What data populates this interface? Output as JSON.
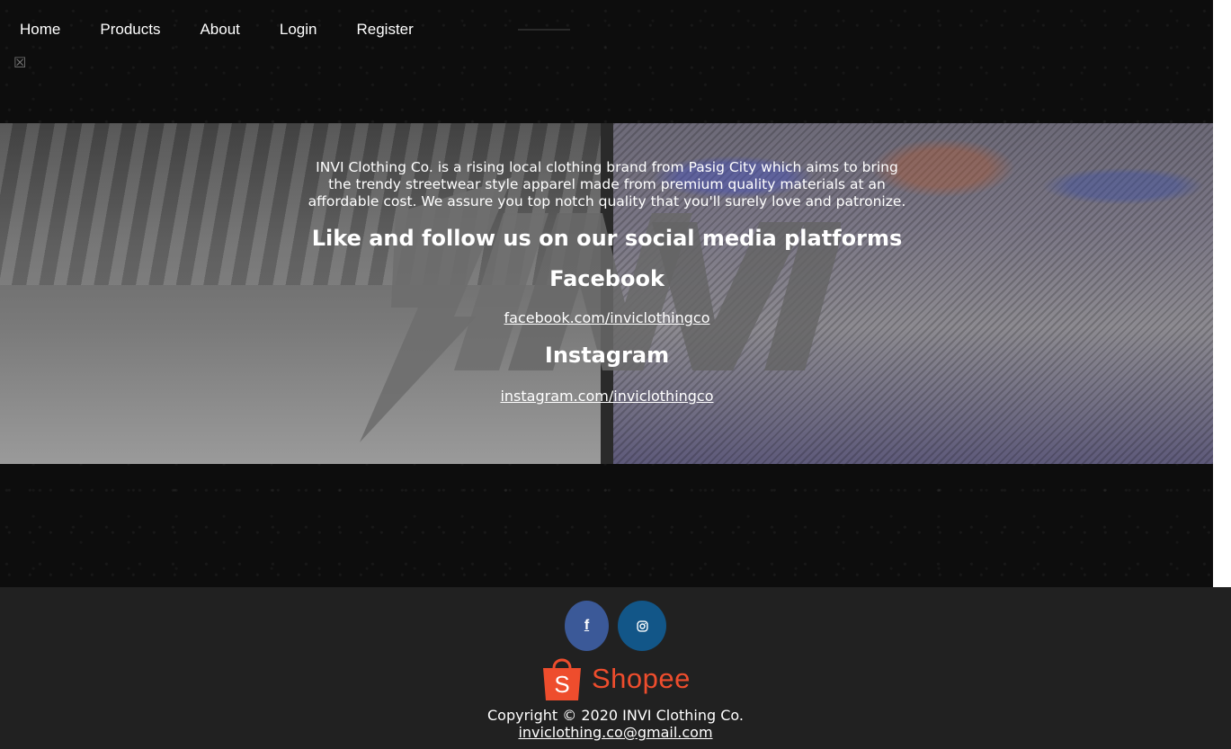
{
  "nav": {
    "items": [
      {
        "label": "Home"
      },
      {
        "label": "Products"
      },
      {
        "label": "About"
      },
      {
        "label": "Login"
      },
      {
        "label": "Register"
      }
    ],
    "menu_toggle_icon": "☒"
  },
  "hero": {
    "description": "INVI Clothing Co. is a rising local clothing brand from Pasig City which aims to bring the trendy streetwear style apparel made from premium quality materials at an affordable cost. We assure you top notch quality that you'll surely love and patronize.",
    "follow_heading": "Like and follow us on our social media platforms",
    "facebook_heading": "Facebook",
    "facebook_link": "facebook.com/inviclothingco",
    "instagram_heading": "Instagram",
    "instagram_link": "instagram.com/inviclothingco"
  },
  "footer": {
    "facebook_icon": "f",
    "instagram_icon": "instagram-icon",
    "shopee_label": "Shopee",
    "copyright": "Copyright © 2020 INVI Clothing Co.",
    "email": "inviclothing.co@gmail.com"
  },
  "colors": {
    "facebook": "#3b5998",
    "instagram": "#125688",
    "shopee": "#ee4d2d",
    "footer_bg": "#212121"
  }
}
